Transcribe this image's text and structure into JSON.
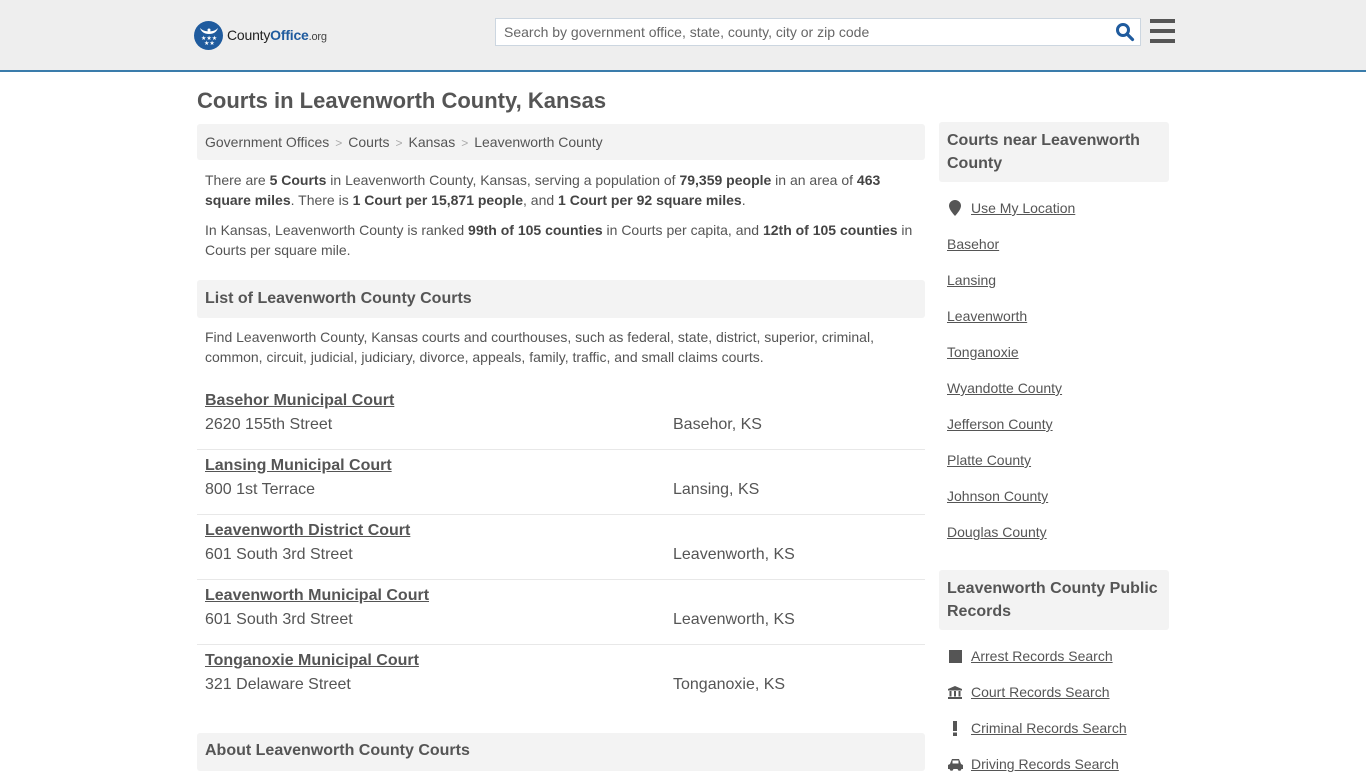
{
  "header": {
    "logo": {
      "brand_part1": "County",
      "brand_part2": "Office",
      "brand_tld": ".org"
    },
    "search": {
      "placeholder": "Search by government office, state, county, city or zip code",
      "value": ""
    },
    "icons": {
      "search": "search-icon",
      "menu": "hamburger-menu-icon"
    }
  },
  "page_title": "Courts in Leavenworth County, Kansas",
  "breadcrumb": [
    {
      "label": "Government Offices"
    },
    {
      "label": "Courts"
    },
    {
      "label": "Kansas"
    },
    {
      "label": "Leavenworth County"
    }
  ],
  "breadcrumb_separator": ">",
  "summary": {
    "p1": {
      "t1": "There are ",
      "b1": "5 Courts",
      "t2": " in Leavenworth County, Kansas, serving a population of ",
      "b2": "79,359 people",
      "t3": " in an area of ",
      "b3": "463 square miles",
      "t4": ". There is ",
      "b4": "1 Court per 15,871 people",
      "t5": ", and ",
      "b5": "1 Court per 92 square miles",
      "t6": "."
    },
    "p2": {
      "t1": "In Kansas, Leavenworth County is ranked ",
      "b1": "99th of 105 counties",
      "t2": " in Courts per capita, and ",
      "b2": "12th of 105 counties",
      "t3": " in Courts per square mile."
    }
  },
  "list_section": {
    "title": "List of Leavenworth County Courts",
    "description": "Find Leavenworth County, Kansas courts and courthouses, such as federal, state, district, superior, criminal, common, circuit, judicial, judiciary, divorce, appeals, family, traffic, and small claims courts."
  },
  "courts": [
    {
      "name": "Basehor Municipal Court",
      "address": "2620 155th Street",
      "city": "Basehor, KS"
    },
    {
      "name": "Lansing Municipal Court",
      "address": "800 1st Terrace",
      "city": "Lansing, KS"
    },
    {
      "name": "Leavenworth District Court",
      "address": "601 South 3rd Street",
      "city": "Leavenworth, KS"
    },
    {
      "name": "Leavenworth Municipal Court",
      "address": "601 South 3rd Street",
      "city": "Leavenworth, KS"
    },
    {
      "name": "Tonganoxie Municipal Court",
      "address": "321 Delaware Street",
      "city": "Tonganoxie, KS"
    }
  ],
  "about_section": {
    "title": "About Leavenworth County Courts"
  },
  "sidebar": {
    "near": {
      "title": "Courts near Leavenworth County",
      "use_location": {
        "label": "Use My Location",
        "icon": "map-marker-icon"
      },
      "links": [
        "Basehor",
        "Lansing",
        "Leavenworth",
        "Tonganoxie",
        "Wyandotte County",
        "Jefferson County",
        "Platte County",
        "Johnson County",
        "Douglas County"
      ]
    },
    "records": {
      "title": "Leavenworth County Public Records",
      "links": [
        {
          "label": "Arrest Records Search",
          "icon": "square-icon"
        },
        {
          "label": "Court Records Search",
          "icon": "courthouse-icon"
        },
        {
          "label": "Criminal Records Search",
          "icon": "exclamation-icon"
        },
        {
          "label": "Driving Records Search",
          "icon": "car-icon"
        }
      ]
    }
  }
}
